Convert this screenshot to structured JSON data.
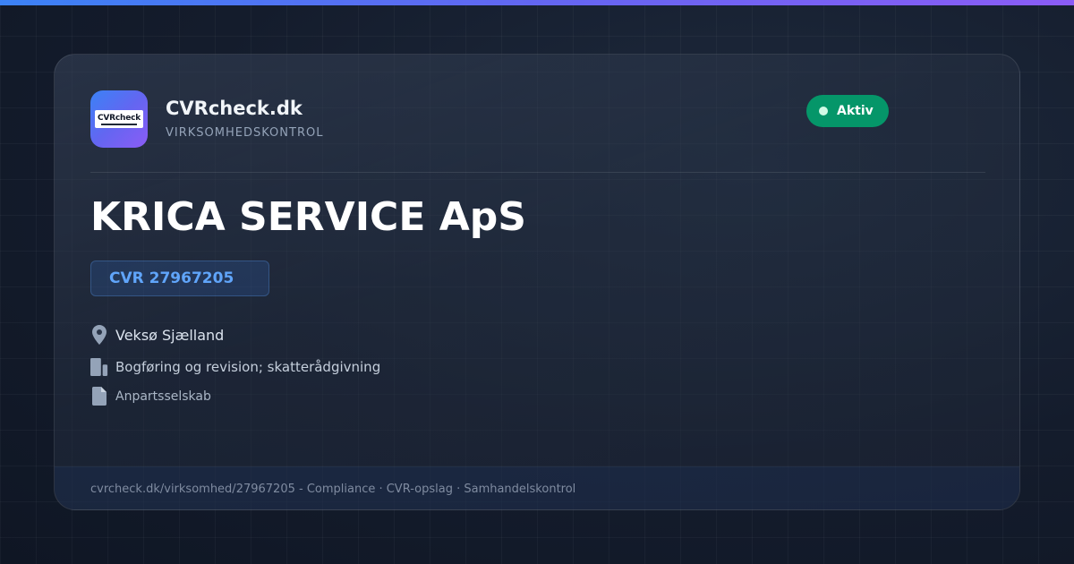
{
  "brand": {
    "logo_text": "CVRcheck",
    "name": "CVRcheck.dk",
    "subtitle": "VIRKSOMHEDSKONTROL"
  },
  "status": {
    "label": "Aktiv",
    "color": "#059669"
  },
  "company": {
    "name": "KRICA SERVICE ApS",
    "cvr": "CVR 27967205",
    "location": "Veksø Sjælland",
    "industry": "Bogføring og revision; skatterådgivning",
    "type": "Anpartsselskab"
  },
  "icons": {
    "location": "location-pin-icon",
    "industry": "building-icon",
    "type": "document-icon"
  },
  "footer": {
    "text": "cvrcheck.dk/virksomhed/27967205 - Compliance · CVR-opslag · Samhandelskontrol"
  },
  "colors": {
    "accent_gradient_start": "#3b82f6",
    "accent_gradient_end": "#8b5cf6",
    "cvr_text": "#60a5fa",
    "background": "#141c2c"
  }
}
